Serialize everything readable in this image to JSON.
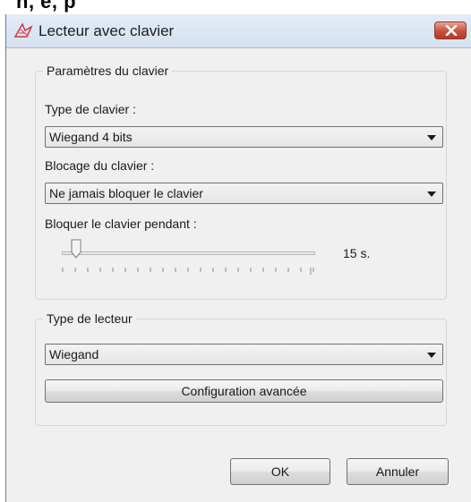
{
  "page": {
    "top_text": "h, e, p"
  },
  "window": {
    "title": "Lecteur avec clavier",
    "icon": "app-icon",
    "close_icon": "close-icon"
  },
  "keyboard_group": {
    "title": "Paramètres du clavier",
    "type_label": "Type de clavier :",
    "type_value": "Wiegand 4 bits",
    "lock_label": "Blocage du clavier :",
    "lock_value": "Ne jamais bloquer le clavier",
    "duration_label": "Bloquer le clavier pendant :",
    "duration_value": "15 s.",
    "slider_level": 0.08
  },
  "reader_group": {
    "title": "Type de lecteur",
    "reader_value": "Wiegand",
    "advanced_button": "Configuration avancée"
  },
  "footer": {
    "ok_label": "OK",
    "cancel_label": "Annuler"
  },
  "colors": {
    "title_bar": "#d9e4f2",
    "close_button": "#c8503c",
    "window_bg": "#f0f0f0"
  }
}
